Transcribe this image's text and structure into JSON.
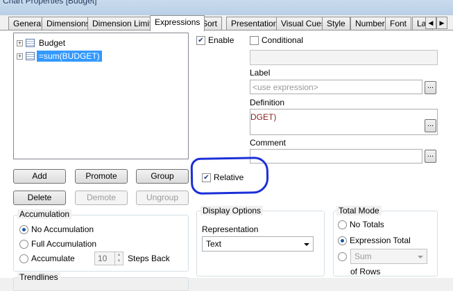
{
  "window": {
    "title": "Chart Properties [Budget]"
  },
  "tabs": [
    "General",
    "Dimensions",
    "Dimension Limits",
    "Expressions",
    "Sort",
    "Presentation",
    "Visual Cues",
    "Style",
    "Number",
    "Font",
    "La"
  ],
  "active_tab": "Expressions",
  "tree": {
    "items": [
      {
        "label": "Budget"
      },
      {
        "label": "=sum(BUDGET)"
      }
    ]
  },
  "buttons": {
    "add": "Add",
    "promote": "Promote",
    "group": "Group",
    "delete": "Delete",
    "demote": "Demote",
    "ungroup": "Ungroup",
    "ellipsis": "..."
  },
  "accumulation": {
    "title": "Accumulation",
    "no_accumulation": "No Accumulation",
    "full_accumulation": "Full Accumulation",
    "accumulate": "Accumulate",
    "steps_value": "10",
    "steps_back": "Steps Back"
  },
  "trendlines": {
    "title": "Trendlines"
  },
  "right": {
    "enable": "Enable",
    "conditional": "Conditional",
    "label_title": "Label",
    "label_placeholder": "<use expression>",
    "definition_title": "Definition",
    "definition_value": "DGET)",
    "comment_title": "Comment",
    "relative": "Relative"
  },
  "display_options": {
    "title": "Display Options",
    "representation_label": "Representation",
    "representation_value": "Text"
  },
  "total_mode": {
    "title": "Total Mode",
    "no_totals": "No Totals",
    "expression_total": "Expression Total",
    "sum": "Sum",
    "of_rows": "of Rows"
  },
  "colors": {
    "selection": "#3399ff",
    "annotation_circle": "#1a2fd8",
    "definition_text": "#8b1c1c"
  }
}
